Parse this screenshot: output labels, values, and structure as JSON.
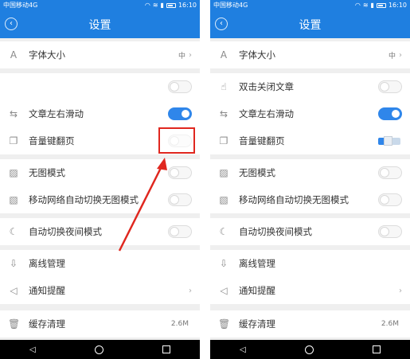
{
  "status_bar": {
    "carrier": "中国移动4G",
    "time": "16:10"
  },
  "app_bar": {
    "title": "设置"
  },
  "left_rows": {
    "font_size": {
      "label": "字体大小",
      "value": "中"
    },
    "swipe": {
      "label": "文章左右滑动"
    },
    "volume": {
      "label": "音量键翻页"
    },
    "no_image": {
      "label": "无图模式"
    },
    "mobile_no_image": {
      "label": "移动网络自动切换无图模式"
    },
    "night": {
      "label": "自动切换夜间模式"
    },
    "offline": {
      "label": "离线管理"
    },
    "notify": {
      "label": "通知提醒"
    },
    "cache": {
      "label": "缓存清理",
      "value": "2.6M"
    }
  },
  "right_rows": {
    "font_size": {
      "label": "字体大小",
      "value": "中"
    },
    "double_tap": {
      "label": "双击关闭文章"
    },
    "swipe": {
      "label": "文章左右滑动"
    },
    "volume": {
      "label": "音量键翻页"
    },
    "no_image": {
      "label": "无图模式"
    },
    "mobile_no_image": {
      "label": "移动网络自动切换无图模式"
    },
    "night": {
      "label": "自动切换夜间模式"
    },
    "offline": {
      "label": "离线管理"
    },
    "notify": {
      "label": "通知提醒"
    },
    "cache": {
      "label": "缓存清理",
      "value": "2.6M"
    }
  },
  "colors": {
    "primary": "#1f7fe0",
    "toggle_on": "#2f86ea",
    "highlight": "#e0271f"
  }
}
